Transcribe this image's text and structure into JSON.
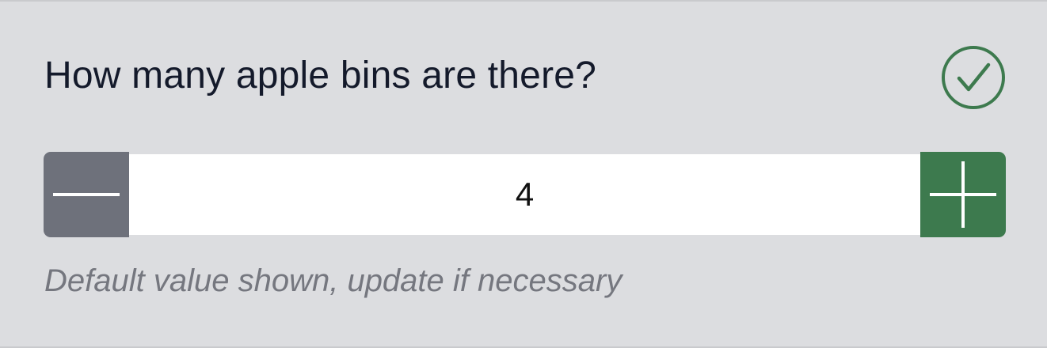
{
  "question": {
    "text": "How many apple bins are there?"
  },
  "status": {
    "icon": "check-circle-icon",
    "color": "#3d7a4e"
  },
  "stepper": {
    "value": "4",
    "decrement_icon": "minus-icon",
    "increment_icon": "plus-icon",
    "decrement_color": "#6e717b",
    "increment_color": "#3d7a4e"
  },
  "hint": {
    "text": "Default value shown, update if necessary"
  }
}
